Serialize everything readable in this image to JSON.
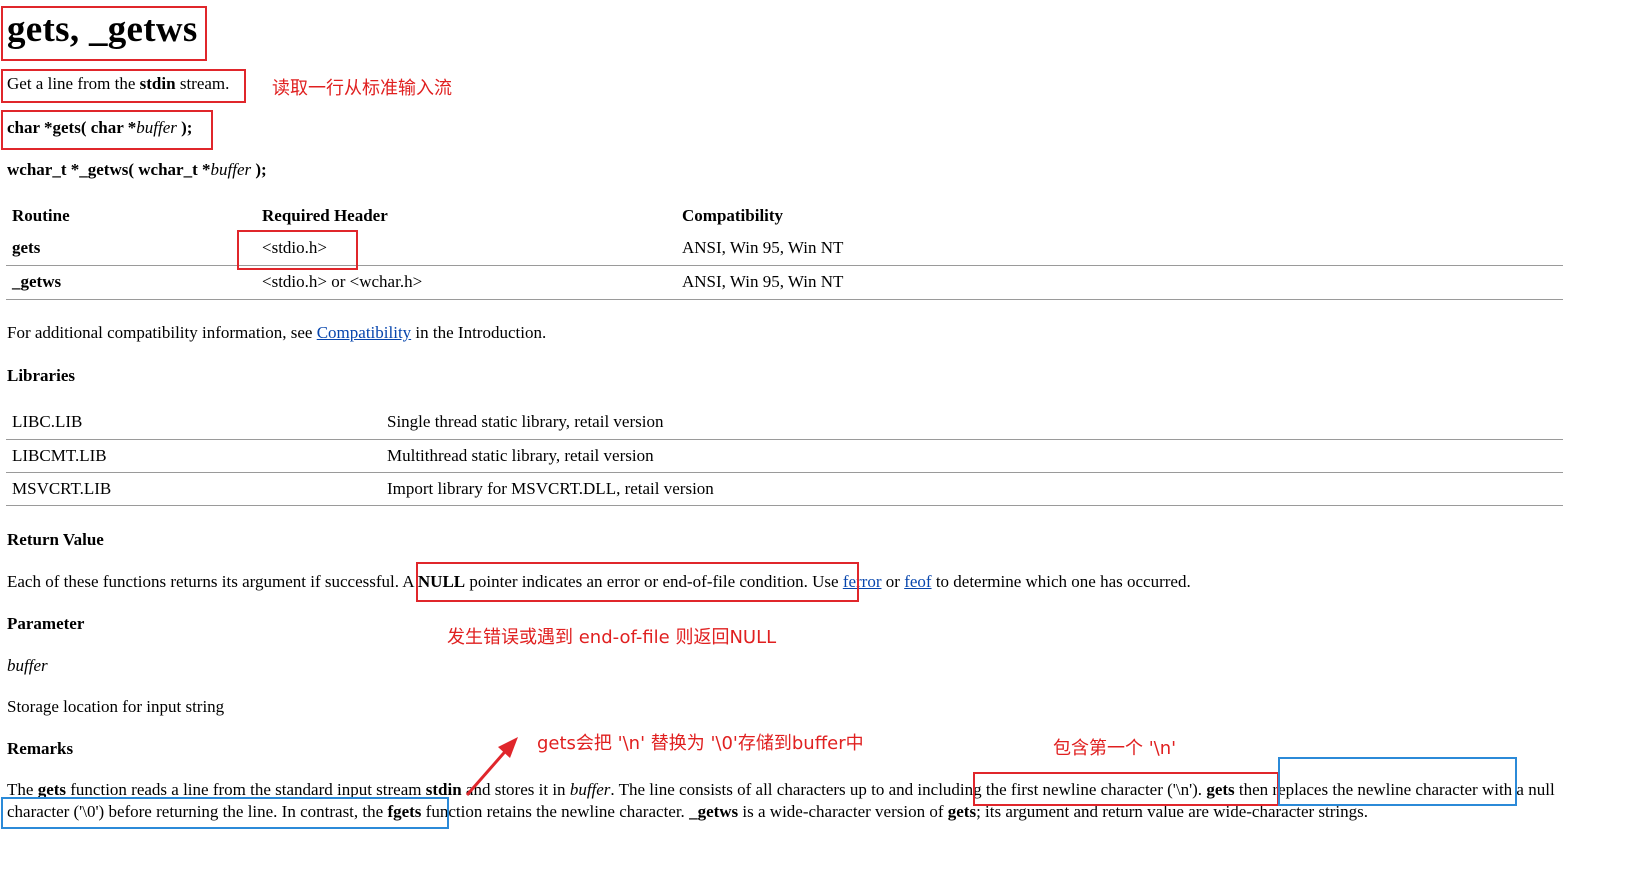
{
  "title": "gets, _getws",
  "summary": {
    "pre": "Get a line from the ",
    "bold": "stdin",
    "post": " stream."
  },
  "prototypes": {
    "gets": {
      "type": "char *",
      "name": "gets",
      "open": "( ",
      "argtype": "char *",
      "arg": "buffer",
      "close": " );"
    },
    "getws": {
      "type": "wchar_t *",
      "name": "_getws",
      "open": "( ",
      "argtype": "wchar_t *",
      "arg": "buffer",
      "close": " );"
    }
  },
  "header_table": {
    "columns": [
      "Routine",
      "Required Header",
      "Compatibility"
    ],
    "rows": [
      [
        "gets",
        "<stdio.h>",
        "ANSI, Win 95, Win NT"
      ],
      [
        "_getws",
        "<stdio.h> or <wchar.h>",
        "ANSI, Win 95, Win NT"
      ]
    ]
  },
  "compat_note": {
    "pre": "For additional compatibility information, see ",
    "link": "Compatibility",
    "post": " in the Introduction."
  },
  "libraries": {
    "heading": "Libraries",
    "rows": [
      [
        "LIBC.LIB",
        "Single thread static library, retail version"
      ],
      [
        "LIBCMT.LIB",
        "Multithread static library, retail version"
      ],
      [
        "MSVCRT.LIB",
        "Import library for MSVCRT.DLL, retail version"
      ]
    ]
  },
  "return_value": {
    "heading": "Return Value",
    "p1": "Each of these functions returns its argument if successful.",
    "p2a": " A ",
    "p2b": "NULL",
    "p2c": " pointer indicates an error or end-of-file condition.",
    "p3a": " Use ",
    "link1": "ferror",
    "p3b": " or ",
    "link2": "feof",
    "p3c": " to determine which one has occurred."
  },
  "parameter": {
    "heading": "Parameter",
    "name": "buffer",
    "desc": "Storage location for input string"
  },
  "remarks": {
    "heading": "Remarks",
    "s1": "The ",
    "s2": "gets",
    "s3": " function reads a line from the standard input stream ",
    "s4": "stdin",
    "s5": " and stores it in ",
    "s6": "buffer",
    "s7": ". The line consists of all characters up to and including the first newline character ('\\n'). ",
    "s8": "gets",
    "s9": " then replaces the newline character with a null character ('\\0') before returning the line. In contrast, the ",
    "s10": "fgets",
    "s11": " function retains the newline character. ",
    "s12": "_getws",
    "s13": " is a wide-character version of ",
    "s14": "gets",
    "s15": "; its argument and return value are wide-character strings."
  },
  "annotations": {
    "read_line": "读取一行从标准输入流",
    "null_return": "发生错误或遇到 end-of-file 则返回NULL",
    "replace_newline": "gets会把 '\\n' 替换为 '\\0'存储到buffer中",
    "include_newline": "包含第一个 '\\n'"
  },
  "colors": {
    "annotation_red": "#e0262b",
    "annotation_blue": "#2b8ad8",
    "link": "#0645ad"
  }
}
